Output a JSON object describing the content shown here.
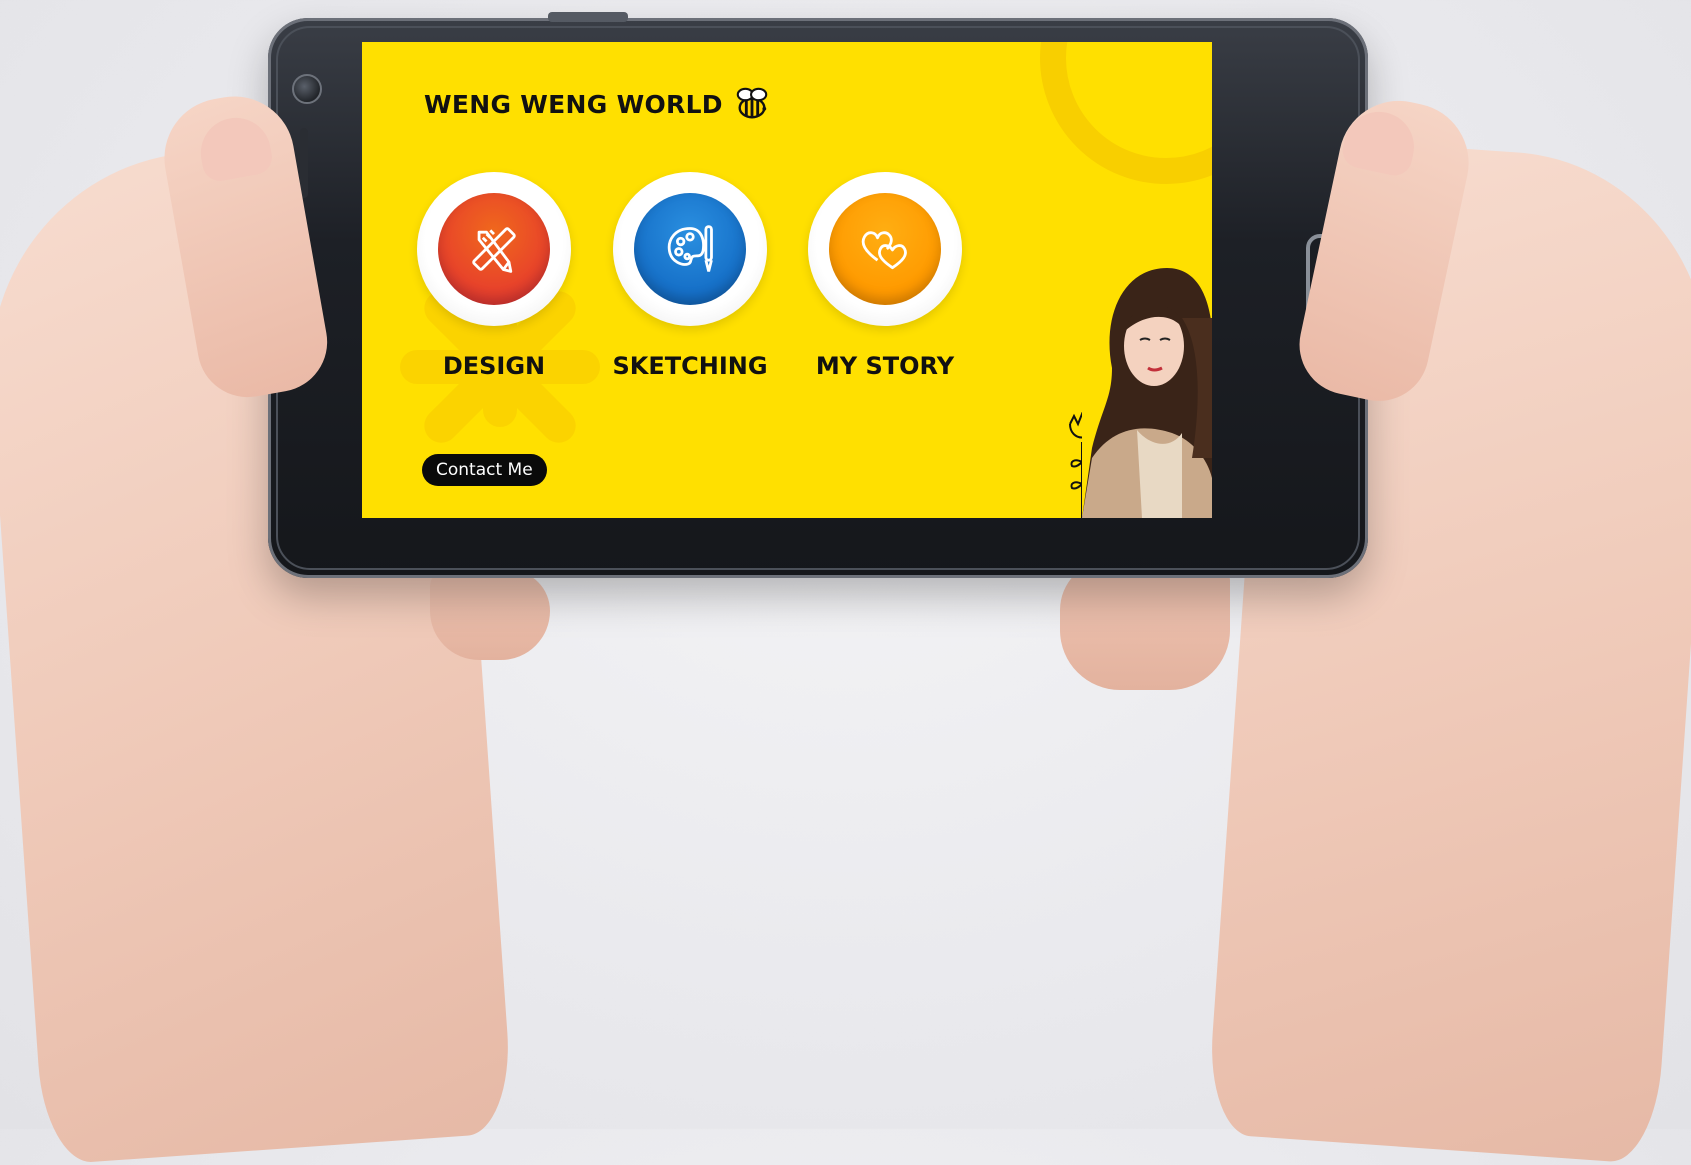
{
  "app": {
    "title": "WENG WENG WORLD",
    "accent_color": "#ffe000",
    "title_icon": "bee-icon"
  },
  "menu": [
    {
      "label": "DESIGN",
      "icon": "pencil-ruler-icon",
      "color": "#e8442a"
    },
    {
      "label": "SKETCHING",
      "icon": "palette-brush-icon",
      "color": "#1670c8"
    },
    {
      "label": "MY STORY",
      "icon": "hearts-icon",
      "color": "#ff9a00"
    }
  ],
  "contact": {
    "label": "Contact Me"
  }
}
